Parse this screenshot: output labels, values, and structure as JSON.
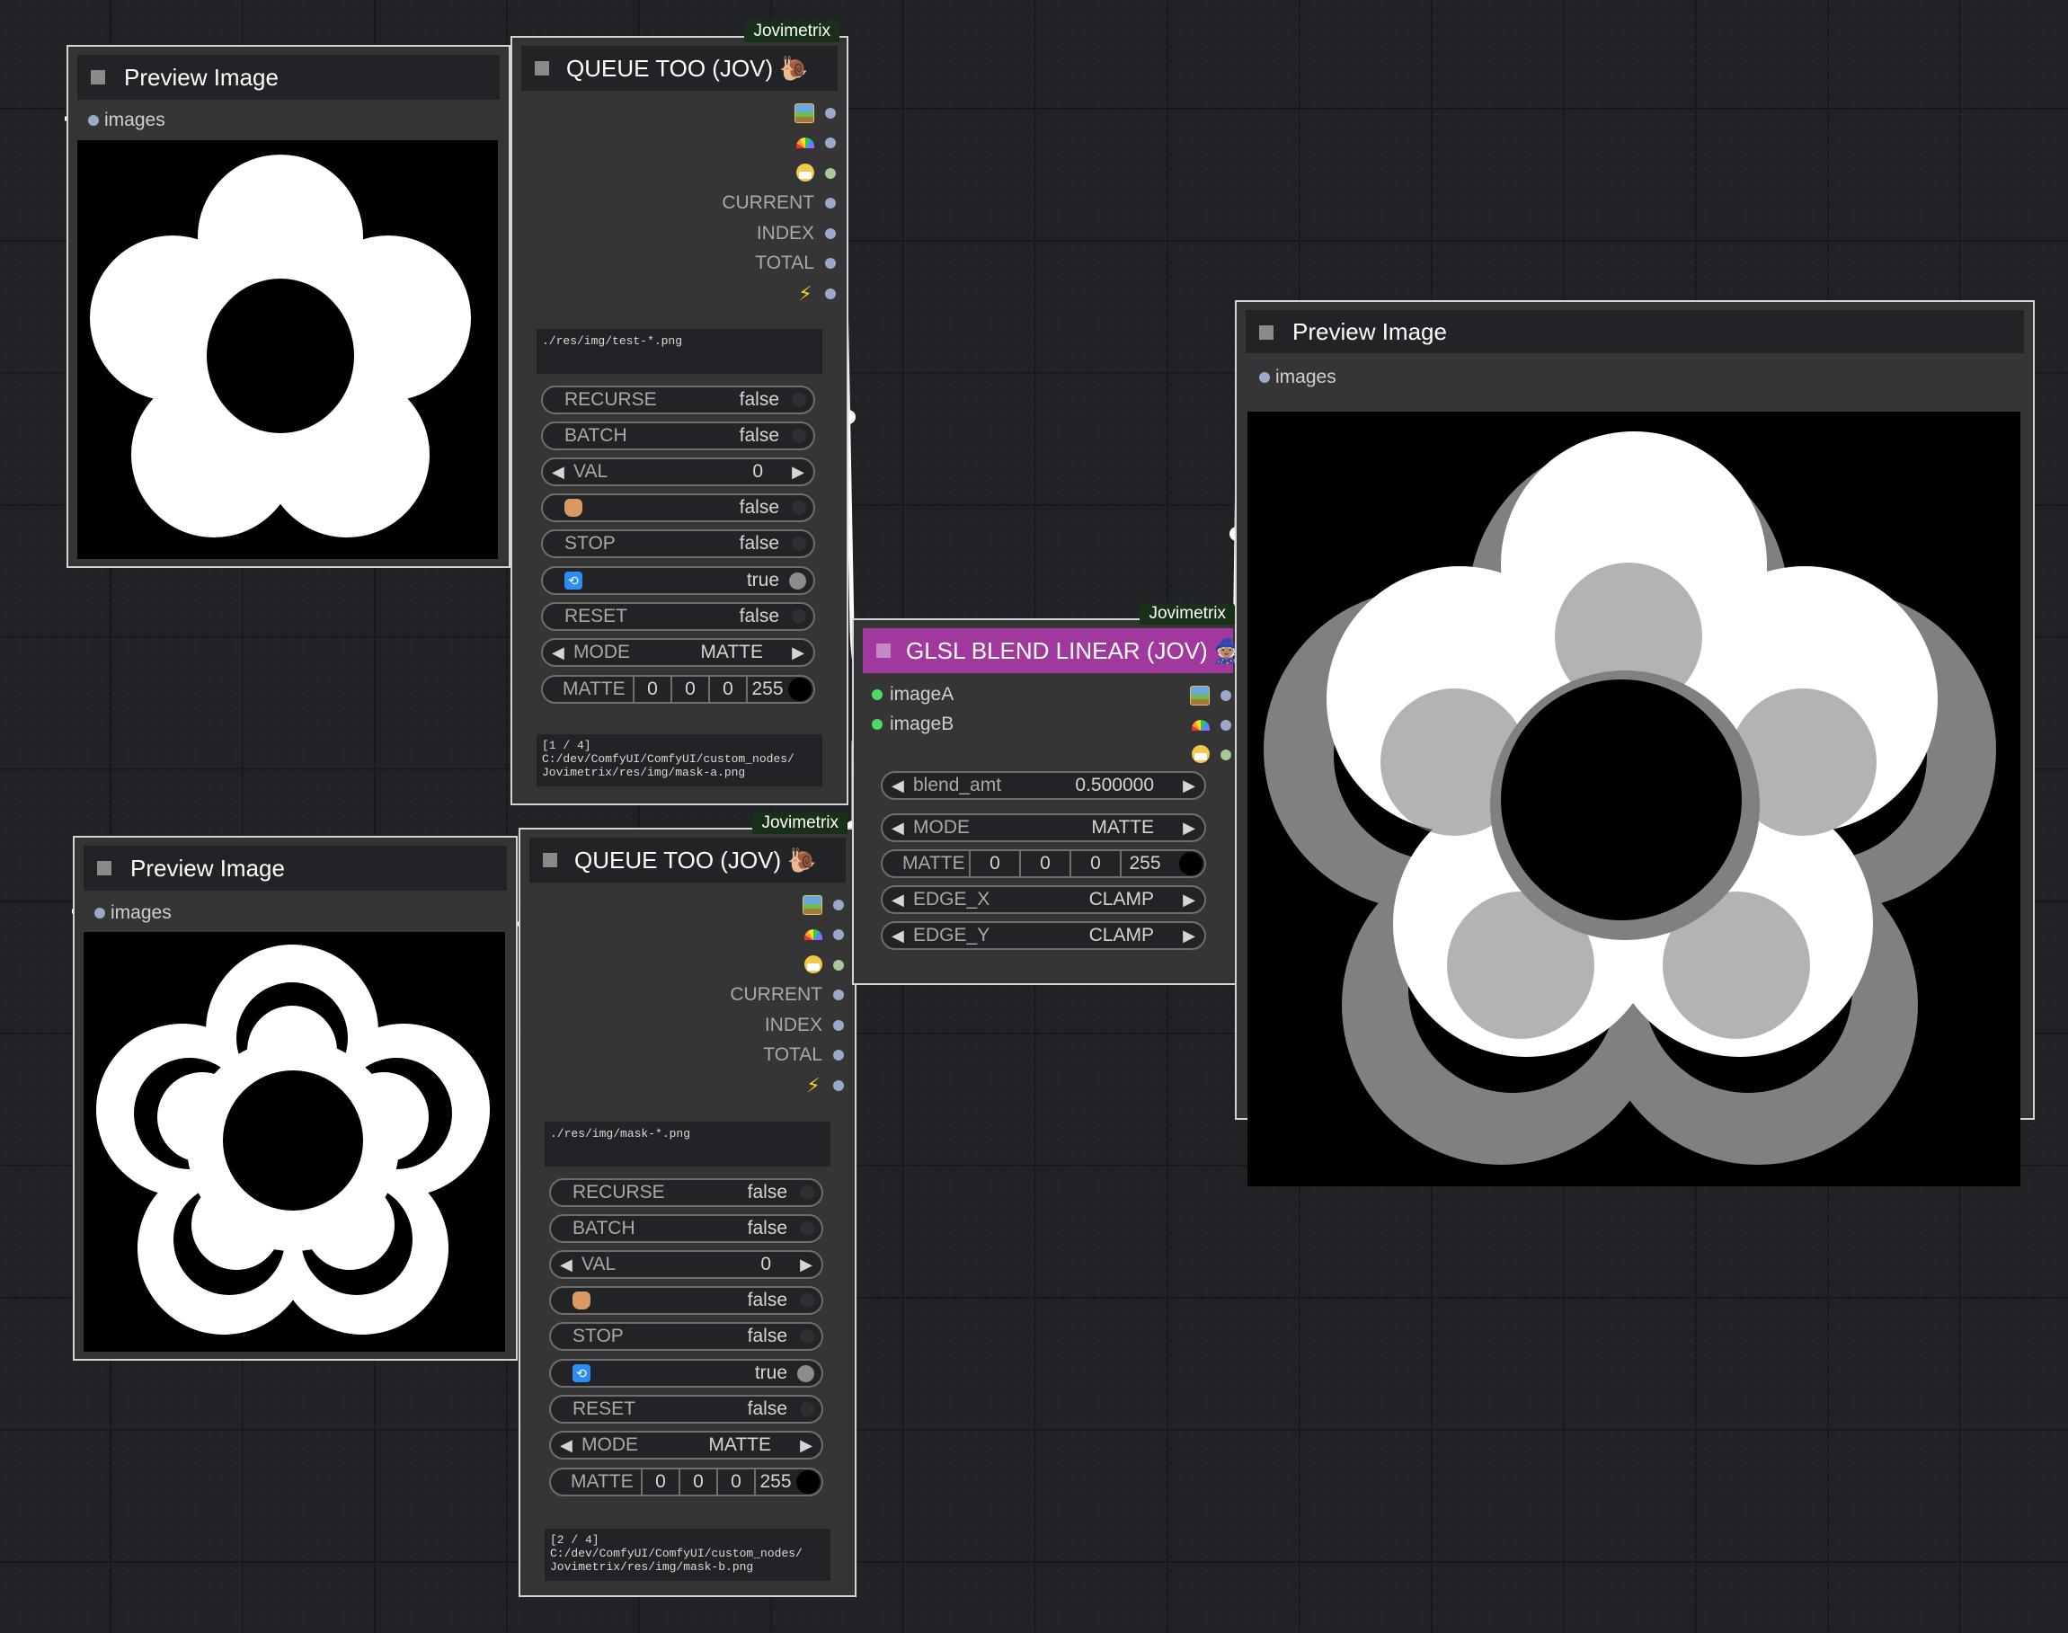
{
  "colors": {
    "canvas_bg": "#202226",
    "node_bg": "#353535",
    "title_bg": "#222326",
    "glsl_title_bg": "#a1389e",
    "badge_bg": "#173017",
    "link_color": "#ffffff",
    "image_slot_dot": "#9aa9c7",
    "mask_slot_dot": "#a9c79a",
    "input_connected_dot": "#4cd964"
  },
  "nodes": {
    "preview_top_left": {
      "title": "Preview Image",
      "input": "images"
    },
    "preview_bottom_left": {
      "title": "Preview Image",
      "input": "images"
    },
    "preview_right": {
      "title": "Preview Image",
      "input": "images"
    },
    "queue_a": {
      "badge": "Jovimetrix",
      "title": "QUEUE TOO (JOV) 🐌",
      "outputs": [
        "image-icon",
        "rainbow-icon",
        "mask-icon",
        "CURRENT",
        "INDEX",
        "TOTAL",
        "bolt-icon"
      ],
      "output_labels": {
        "current": "CURRENT",
        "index": "INDEX",
        "total": "TOTAL"
      },
      "queue_text": "./res/img/test-*.png",
      "widgets": {
        "recurse": {
          "label": "RECURSE",
          "value": "false"
        },
        "batch": {
          "label": "BATCH",
          "value": "false"
        },
        "val": {
          "label": "VAL",
          "value": "0"
        },
        "hold": {
          "icon": "hand-icon",
          "value": "false"
        },
        "stop": {
          "label": "STOP",
          "value": "false"
        },
        "loop": {
          "icon": "cycle-icon",
          "value": "true"
        },
        "reset": {
          "label": "RESET",
          "value": "false"
        },
        "mode": {
          "label": "MODE",
          "value": "MATTE"
        },
        "matte": {
          "label": "MATTE",
          "r": "0",
          "g": "0",
          "b": "0",
          "a": "255"
        }
      },
      "status_text": "[1 / 4]\nC:/dev/ComfyUI/ComfyUI/custom_nodes/\nJovimetrix/res/img/mask-a.png"
    },
    "queue_b": {
      "badge": "Jovimetrix",
      "title": "QUEUE TOO (JOV) 🐌",
      "output_labels": {
        "current": "CURRENT",
        "index": "INDEX",
        "total": "TOTAL"
      },
      "queue_text": "./res/img/mask-*.png",
      "widgets": {
        "recurse": {
          "label": "RECURSE",
          "value": "false"
        },
        "batch": {
          "label": "BATCH",
          "value": "false"
        },
        "val": {
          "label": "VAL",
          "value": "0"
        },
        "hold": {
          "icon": "hand-icon",
          "value": "false"
        },
        "stop": {
          "label": "STOP",
          "value": "false"
        },
        "loop": {
          "icon": "cycle-icon",
          "value": "true"
        },
        "reset": {
          "label": "RESET",
          "value": "false"
        },
        "mode": {
          "label": "MODE",
          "value": "MATTE"
        },
        "matte": {
          "label": "MATTE",
          "r": "0",
          "g": "0",
          "b": "0",
          "a": "255"
        }
      },
      "status_text": "[2 / 4]\nC:/dev/ComfyUI/ComfyUI/custom_nodes/\nJovimetrix/res/img/mask-b.png"
    },
    "glsl": {
      "badge": "Jovimetrix",
      "title": "GLSL BLEND LINEAR (JOV) 🧙🏽",
      "inputs": {
        "a": "imageA",
        "b": "imageB"
      },
      "widgets": {
        "blend_amt": {
          "label": "blend_amt",
          "value": "0.500000"
        },
        "mode": {
          "label": "MODE",
          "value": "MATTE"
        },
        "matte": {
          "label": "MATTE",
          "r": "0",
          "g": "0",
          "b": "0",
          "a": "255"
        },
        "edge_x": {
          "label": "EDGE_X",
          "value": "CLAMP"
        },
        "edge_y": {
          "label": "EDGE_Y",
          "value": "CLAMP"
        }
      }
    }
  }
}
